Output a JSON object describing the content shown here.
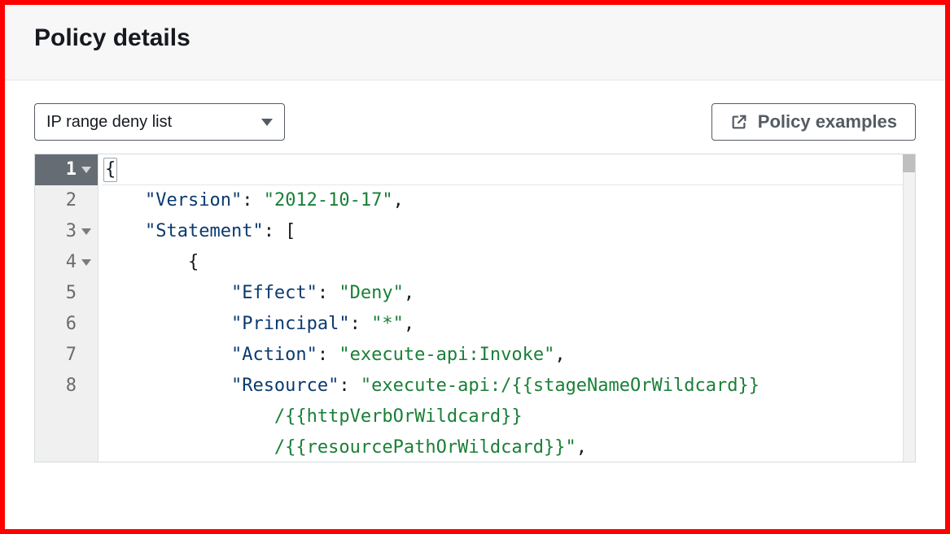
{
  "header": {
    "title": "Policy details"
  },
  "toolbar": {
    "select_value": "IP range deny list",
    "examples_label": "Policy examples"
  },
  "editor": {
    "lines": [
      {
        "n": "1",
        "foldable": true,
        "active": true,
        "tokens": [
          {
            "t": "{",
            "c": "p",
            "boxed": true
          }
        ]
      },
      {
        "n": "2",
        "tokens": [
          {
            "t": "    ",
            "c": "p"
          },
          {
            "t": "\"Version\"",
            "c": "k"
          },
          {
            "t": ": ",
            "c": "p"
          },
          {
            "t": "\"2012-10-17\"",
            "c": "s"
          },
          {
            "t": ",",
            "c": "p"
          }
        ]
      },
      {
        "n": "3",
        "foldable": true,
        "tokens": [
          {
            "t": "    ",
            "c": "p"
          },
          {
            "t": "\"Statement\"",
            "c": "k"
          },
          {
            "t": ": [",
            "c": "p"
          }
        ]
      },
      {
        "n": "4",
        "foldable": true,
        "tokens": [
          {
            "t": "        {",
            "c": "p"
          }
        ]
      },
      {
        "n": "5",
        "tokens": [
          {
            "t": "            ",
            "c": "p"
          },
          {
            "t": "\"Effect\"",
            "c": "k"
          },
          {
            "t": ": ",
            "c": "p"
          },
          {
            "t": "\"Deny\"",
            "c": "s"
          },
          {
            "t": ",",
            "c": "p"
          }
        ]
      },
      {
        "n": "6",
        "tokens": [
          {
            "t": "            ",
            "c": "p"
          },
          {
            "t": "\"Principal\"",
            "c": "k"
          },
          {
            "t": ": ",
            "c": "p"
          },
          {
            "t": "\"*\"",
            "c": "s"
          },
          {
            "t": ",",
            "c": "p"
          }
        ]
      },
      {
        "n": "7",
        "tokens": [
          {
            "t": "            ",
            "c": "p"
          },
          {
            "t": "\"Action\"",
            "c": "k"
          },
          {
            "t": ": ",
            "c": "p"
          },
          {
            "t": "\"execute-api:Invoke\"",
            "c": "s"
          },
          {
            "t": ",",
            "c": "p"
          }
        ]
      },
      {
        "n": "8",
        "tokens": [
          {
            "t": "            ",
            "c": "p"
          },
          {
            "t": "\"Resource\"",
            "c": "k"
          },
          {
            "t": ": ",
            "c": "p"
          },
          {
            "t": "\"execute-api:/{{stageNameOrWildcard}}",
            "c": "s"
          }
        ]
      },
      {
        "n": "",
        "tokens": [
          {
            "t": "                /{{httpVerbOrWildcard}}",
            "c": "s"
          }
        ]
      },
      {
        "n": "",
        "tokens": [
          {
            "t": "                /{{resourcePathOrWildcard}}\"",
            "c": "s"
          },
          {
            "t": ",",
            "c": "p"
          }
        ]
      }
    ]
  }
}
